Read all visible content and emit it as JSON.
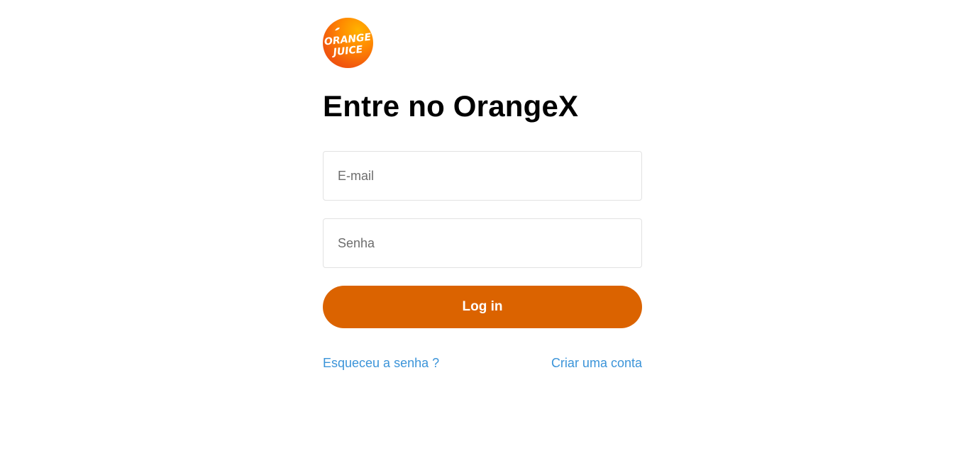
{
  "brand": {
    "logo_line1": "ORANGE",
    "logo_line2": "JUICE",
    "logo_icon": "orange-juice-logo"
  },
  "heading": {
    "title": "Entre no OrangeX"
  },
  "form": {
    "email_placeholder": "E-mail",
    "email_value": "",
    "password_placeholder": "Senha",
    "password_value": "",
    "login_label": "Log in"
  },
  "links": {
    "forgot_password": "Esqueceu a senha ?",
    "create_account": "Criar uma conta"
  },
  "colors": {
    "primary_button": "#db6300",
    "link": "#3b94d9",
    "input_border": "#e2e2e2"
  }
}
